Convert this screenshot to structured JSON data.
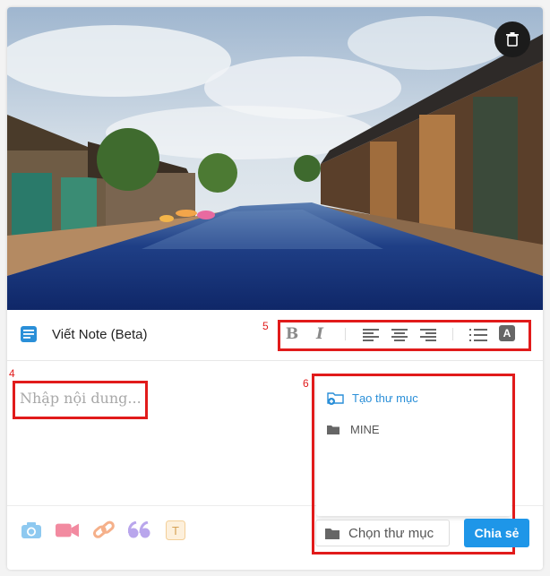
{
  "header": {
    "title": "Viết Note (Beta)"
  },
  "annotations": {
    "toolbar_marker": "5",
    "editor_marker": "4",
    "folder_marker": "6"
  },
  "toolbar": {
    "bold_label": "B",
    "italic_label": "I",
    "highlight_label": "A"
  },
  "editor": {
    "placeholder": "Nhập nội dung..."
  },
  "folder_panel": {
    "create_label": "Tạo thư mục",
    "folders": [
      "MINE"
    ]
  },
  "footer": {
    "select_folder_label": "Chọn thư mục",
    "share_label": "Chia sẻ",
    "tool_icons": [
      "camera-icon",
      "video-icon",
      "link-icon",
      "quote-icon",
      "text-icon"
    ]
  },
  "colors": {
    "accent": "#1e96e8",
    "annotation": "#e11b1b"
  }
}
